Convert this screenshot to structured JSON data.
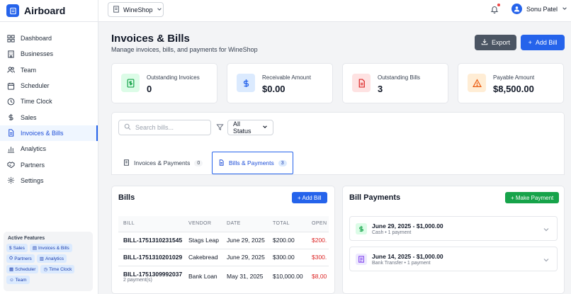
{
  "app": {
    "name": "Airboard"
  },
  "sidebar": {
    "items": [
      {
        "label": "Dashboard",
        "icon": "grid-icon"
      },
      {
        "label": "Businesses",
        "icon": "building-icon"
      },
      {
        "label": "Team",
        "icon": "users-icon"
      },
      {
        "label": "Scheduler",
        "icon": "calendar-icon"
      },
      {
        "label": "Time Clock",
        "icon": "clock-icon"
      },
      {
        "label": "Sales",
        "icon": "dollar-icon"
      },
      {
        "label": "Invoices & Bills",
        "icon": "file-icon",
        "active": true
      },
      {
        "label": "Analytics",
        "icon": "bar-chart-icon"
      },
      {
        "label": "Partners",
        "icon": "handshake-icon"
      },
      {
        "label": "Settings",
        "icon": "gear-icon"
      }
    ],
    "features": {
      "title": "Active Features",
      "chips": [
        "Sales",
        "Invoices & Bills",
        "Partners",
        "Analytics",
        "Scheduler",
        "Time Clock",
        "Team"
      ]
    }
  },
  "topbar": {
    "shop": "WineShop",
    "user_name": "Sonu Patel"
  },
  "page": {
    "title": "Invoices & Bills",
    "subtitle": "Manage invoices, bills, and payments for WineShop",
    "export_label": "Export",
    "add_bill_label": "Add Bill"
  },
  "stats": [
    {
      "label": "Outstanding Invoices",
      "value": "0",
      "color": "#16a34a",
      "bg": "#dcfce7",
      "icon": "dollar-doc-icon"
    },
    {
      "label": "Receivable Amount",
      "value": "$0.00",
      "color": "#2563eb",
      "bg": "#dbeafe",
      "icon": "dollar-icon"
    },
    {
      "label": "Outstanding Bills",
      "value": "3",
      "color": "#dc2626",
      "bg": "#fee2e2",
      "icon": "file-icon"
    },
    {
      "label": "Payable Amount",
      "value": "$8,500.00",
      "color": "#ea580c",
      "bg": "#ffedd5",
      "icon": "warning-icon"
    }
  ],
  "filters": {
    "search_placeholder": "Search bills...",
    "status": "All Status"
  },
  "tabs": [
    {
      "label": "Invoices & Payments",
      "count": "0"
    },
    {
      "label": "Bills & Payments",
      "count": "3",
      "active": true
    }
  ],
  "bills": {
    "title": "Bills",
    "add_label": "+ Add Bill",
    "columns": [
      "BILL",
      "VENDOR",
      "DATE",
      "TOTAL",
      "OPEN"
    ],
    "rows": [
      {
        "bill": "BILL-1751310231545",
        "sub": "",
        "vendor": "Stags Leap",
        "date": "June 29, 2025",
        "total": "$200.00",
        "open": "$200."
      },
      {
        "bill": "BILL-1751310201029",
        "sub": "",
        "vendor": "Cakebread",
        "date": "June 29, 2025",
        "total": "$300.00",
        "open": "$300."
      },
      {
        "bill": "BILL-1751309992037",
        "sub": "2 payment(s)",
        "vendor": "Bank Loan",
        "date": "May 31, 2025",
        "total": "$10,000.00",
        "open": "$8,00"
      }
    ]
  },
  "payments": {
    "title": "Bill Payments",
    "add_label": "+ Make Payment",
    "items": [
      {
        "title": "June 29, 2025 - $1,000.00",
        "sub": "Cash • 1 payment",
        "color": "#16a34a",
        "bg": "#dcfce7",
        "icon": "dollar-icon"
      },
      {
        "title": "June 14, 2025 - $1,000.00",
        "sub": "Bank Transfer • 1 payment",
        "color": "#7c3aed",
        "bg": "#ede9fe",
        "icon": "bank-doc-icon"
      }
    ]
  }
}
